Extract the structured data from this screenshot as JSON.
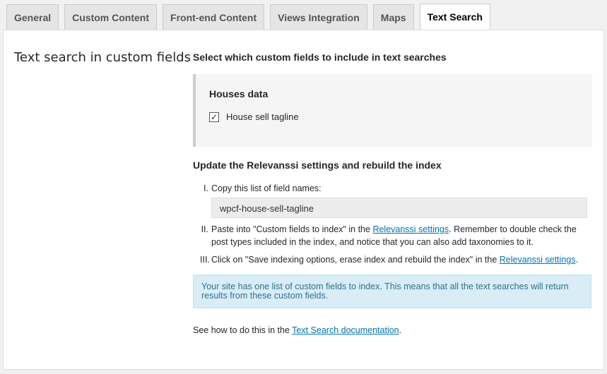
{
  "tabs": [
    {
      "label": "General",
      "active": false
    },
    {
      "label": "Custom Content",
      "active": false
    },
    {
      "label": "Front-end Content",
      "active": false
    },
    {
      "label": "Views Integration",
      "active": false
    },
    {
      "label": "Maps",
      "active": false
    },
    {
      "label": "Text Search",
      "active": true
    }
  ],
  "section": {
    "label": "Text search in custom fields"
  },
  "select_fields": {
    "heading": "Select which custom fields to include in text searches",
    "group_title": "Houses data",
    "field": {
      "label": "House sell tagline",
      "checked": true,
      "check_glyph": "✓"
    }
  },
  "update": {
    "heading": "Update the Relevanssi settings and rebuild the index",
    "steps": [
      {
        "numeral": "I.",
        "text": "Copy this list of field names:"
      },
      {
        "numeral": "II.",
        "text_before": "Paste into \"Custom fields to index\" in the ",
        "link": "Relevanssi settings",
        "text_after": ". Remember to double check the post types included in the index, and notice that you can also add taxonomies to it."
      },
      {
        "numeral": "III.",
        "text_before": "Click on \"Save indexing options, erase index and rebuild the index\" in the ",
        "link": "Relevanssi settings",
        "text_after": "."
      }
    ],
    "field_names": "wpcf-house-sell-tagline"
  },
  "notice": {
    "text": "Your site has one list of custom fields to index. This means that all the text searches will return results from these custom fields."
  },
  "footer": {
    "text_before": "See how to do this in the ",
    "link": "Text Search documentation",
    "text_after": "."
  },
  "colors": {
    "link": "#0073aa",
    "notice_bg": "#d9edf7",
    "notice_text": "#31708f"
  }
}
